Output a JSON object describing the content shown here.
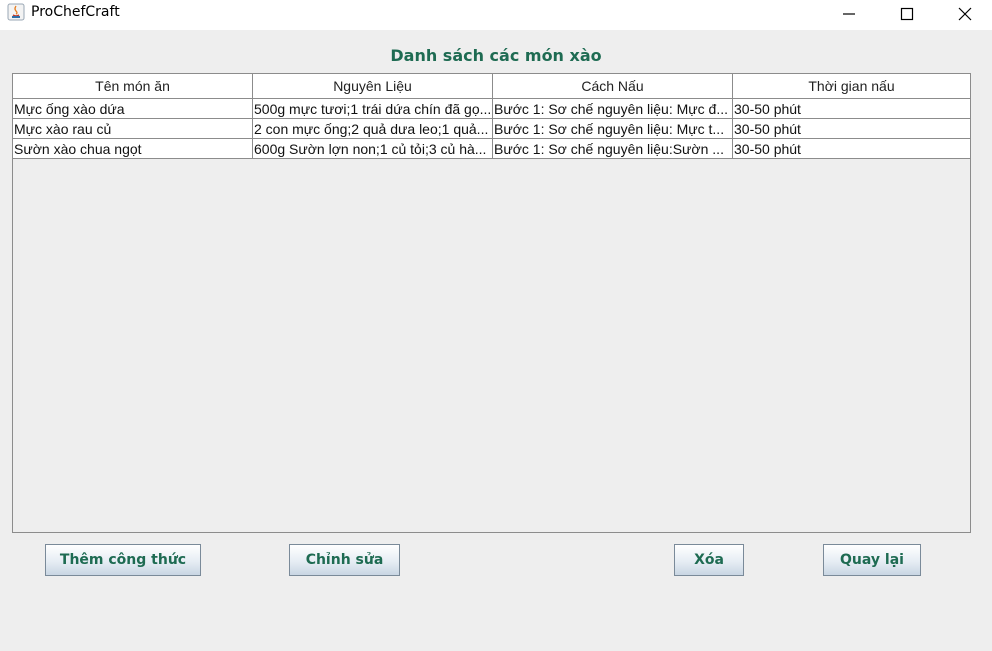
{
  "window": {
    "title": "ProChefCraft",
    "minimize_icon": "minimize-icon",
    "maximize_icon": "maximize-icon",
    "close_icon": "close-icon"
  },
  "heading": "Danh sách các món xào",
  "table": {
    "columns": [
      "Tên món ăn",
      "Nguyên Liệu",
      "Cách Nấu",
      "Thời gian nấu"
    ],
    "rows": [
      [
        "Mực ống xào dứa",
        "500g mực tươi;1 trái dứa chín đã gọ...",
        "Bước 1: Sơ chế nguyên liệu: Mực đ...",
        "30-50 phút"
      ],
      [
        "Mực xào rau củ",
        "2 con mực ống;2 quả dưa leo;1 quả...",
        "Bước 1: Sơ chế nguyên liệu: Mực t...",
        "30-50 phút"
      ],
      [
        "Sườn xào chua ngọt",
        "600g Sườn lợn non;1 củ tỏi;3 củ hà...",
        "Bước 1: Sơ chế nguyên liệu:Sườn ...",
        "30-50 phút"
      ]
    ]
  },
  "buttons": {
    "add": "Thêm công thức",
    "edit": "Chỉnh sửa",
    "delete": "Xóa",
    "back": "Quay lại"
  },
  "colors": {
    "accent": "#1e6b52",
    "background": "#eeeeee",
    "grid": "#8c8c8c"
  }
}
